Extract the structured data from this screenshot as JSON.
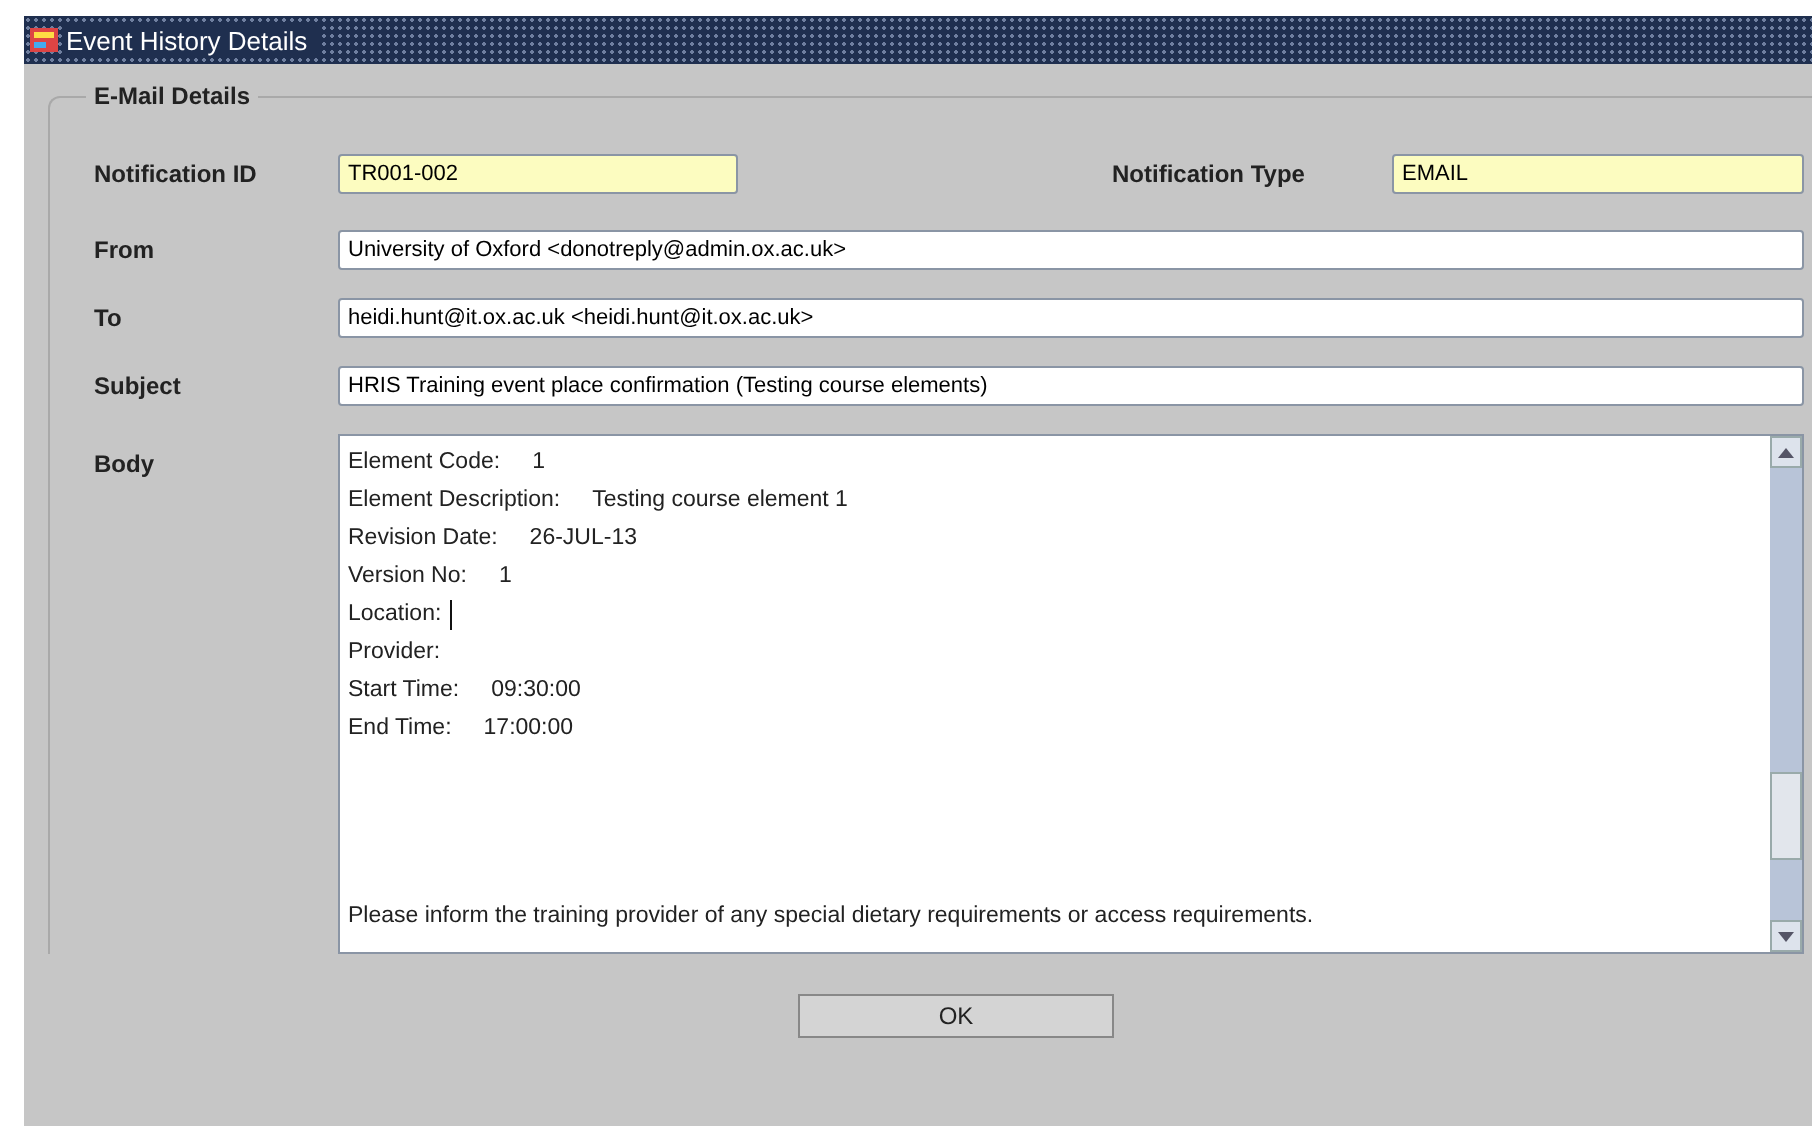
{
  "window": {
    "title": "Event History Details"
  },
  "group": {
    "title": "E-Mail Details"
  },
  "notification_id": {
    "label": "Notification ID",
    "value": "TR001-002"
  },
  "notification_type": {
    "label": "Notification Type",
    "value": "EMAIL"
  },
  "fields": [
    {
      "label": "From",
      "value": "University of Oxford <donotreply@admin.ox.ac.uk>"
    },
    {
      "label": "To",
      "value": "heidi.hunt@it.ox.ac.uk <heidi.hunt@it.ox.ac.uk>"
    },
    {
      "label": "Subject",
      "value": "HRIS Training event place confirmation (Testing course elements)"
    }
  ],
  "body": {
    "label": "Body",
    "lines": [
      {
        "label": "Element Code:",
        "value": "1"
      },
      {
        "label": "Element Description:",
        "value": "Testing course element 1"
      },
      {
        "label": "Revision Date:",
        "value": "26-JUL-13"
      },
      {
        "label": "Version No:",
        "value": "1"
      },
      {
        "label": "Location:",
        "cursor": true
      },
      {
        "label": "Provider:"
      },
      {
        "label": "Start Time:",
        "value": "09:30:00"
      },
      {
        "label": "End Time:",
        "value": "17:00:00"
      }
    ],
    "footer": "Please inform the training provider of any special dietary requirements or access requirements."
  },
  "buttons": [
    "OK"
  ]
}
